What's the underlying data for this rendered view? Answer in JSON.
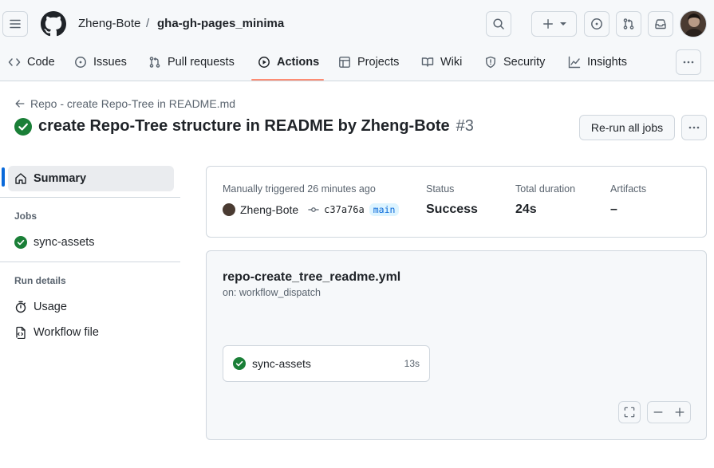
{
  "header": {
    "owner": "Zheng-Bote",
    "separator": "/",
    "repo": "gha-gh-pages_minima"
  },
  "nav": {
    "tabs": [
      {
        "label": "Code",
        "icon": "code-icon"
      },
      {
        "label": "Issues",
        "icon": "issue-icon"
      },
      {
        "label": "Pull requests",
        "icon": "pull-request-icon"
      },
      {
        "label": "Actions",
        "icon": "play-icon",
        "active": true
      },
      {
        "label": "Projects",
        "icon": "table-icon"
      },
      {
        "label": "Wiki",
        "icon": "book-icon"
      },
      {
        "label": "Security",
        "icon": "shield-icon"
      },
      {
        "label": "Insights",
        "icon": "graph-icon"
      }
    ]
  },
  "run": {
    "back_label": "Repo - create Repo-Tree in README.md",
    "title": "create Repo-Tree structure in README by Zheng-Bote",
    "number": "#3",
    "rerun_label": "Re-run all jobs"
  },
  "sidebar": {
    "summary": "Summary",
    "jobs_header": "Jobs",
    "jobs": [
      "sync-assets"
    ],
    "run_details_header": "Run details",
    "usage": "Usage",
    "workflow_file": "Workflow file"
  },
  "summary": {
    "trigger": "Manually triggered 26 minutes ago",
    "actor": "Zheng-Bote",
    "commit": "c37a76a",
    "branch": "main",
    "status_label": "Status",
    "status_value": "Success",
    "duration_label": "Total duration",
    "duration_value": "24s",
    "artifacts_label": "Artifacts",
    "artifacts_value": "–"
  },
  "workflow": {
    "file": "repo-create_tree_readme.yml",
    "trigger": "on: workflow_dispatch",
    "job_name": "sync-assets",
    "job_duration": "13s"
  },
  "colors": {
    "success": "#1a7f37",
    "accent": "#0969da",
    "active_tab_underline": "#fd8c73"
  }
}
